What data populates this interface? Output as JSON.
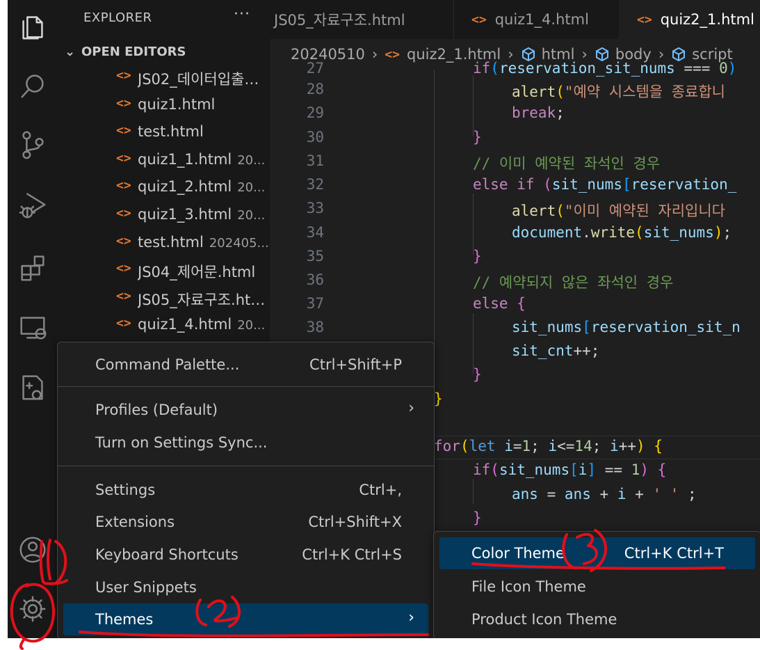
{
  "sidebar": {
    "title": "EXPLORER",
    "more": "···",
    "section": "OPEN EDITORS",
    "files": [
      {
        "name": "JS02_데이터입출력.html",
        "desc": ""
      },
      {
        "name": "quiz1.html",
        "desc": ""
      },
      {
        "name": "test.html",
        "desc": ""
      },
      {
        "name": "quiz1_1.html",
        "desc": "20..."
      },
      {
        "name": "quiz1_2.html",
        "desc": "20..."
      },
      {
        "name": "quiz1_3.html",
        "desc": "20..."
      },
      {
        "name": "test.html",
        "desc": "202405..."
      },
      {
        "name": "JS04_제어문.html",
        "desc": ""
      },
      {
        "name": "JS05_자료구조.html",
        "desc": ""
      },
      {
        "name": "quiz1_4.html",
        "desc": "20..."
      }
    ]
  },
  "tabs": [
    {
      "label": "JS05_자료구조.html"
    },
    {
      "label": "quiz1_4.html"
    },
    {
      "label": "quiz2_1.html"
    }
  ],
  "breadcrumb": {
    "folder": "20240510",
    "file": "quiz2_1.html",
    "html": "html",
    "body": "body",
    "script": "script"
  },
  "editor": {
    "line_numbers": [
      "27",
      "28",
      "29",
      "30",
      "31",
      "32",
      "33",
      "34",
      "35",
      "36",
      "37",
      "38"
    ]
  },
  "gear_menu": {
    "items": [
      {
        "label": "Command Palette...",
        "shortcut": "Ctrl+Shift+P"
      },
      {
        "label": "Profiles (Default)",
        "shortcut": ""
      },
      {
        "label": "Turn on Settings Sync...",
        "shortcut": ""
      },
      {
        "label": "Settings",
        "shortcut": "Ctrl+,"
      },
      {
        "label": "Extensions",
        "shortcut": "Ctrl+Shift+X"
      },
      {
        "label": "Keyboard Shortcuts",
        "shortcut": "Ctrl+K Ctrl+S"
      },
      {
        "label": "User Snippets",
        "shortcut": ""
      },
      {
        "label": "Themes",
        "shortcut": ""
      }
    ]
  },
  "themes_menu": {
    "items": [
      {
        "label": "Color Theme",
        "shortcut": "Ctrl+K Ctrl+T"
      },
      {
        "label": "File Icon Theme",
        "shortcut": ""
      },
      {
        "label": "Product Icon Theme",
        "shortcut": ""
      }
    ]
  },
  "annotations": {
    "one": "1",
    "two": "2",
    "three": "3"
  },
  "colors": {
    "accent": "#04395e",
    "html_icon": "#e37933",
    "annotation": "#e0101a"
  }
}
